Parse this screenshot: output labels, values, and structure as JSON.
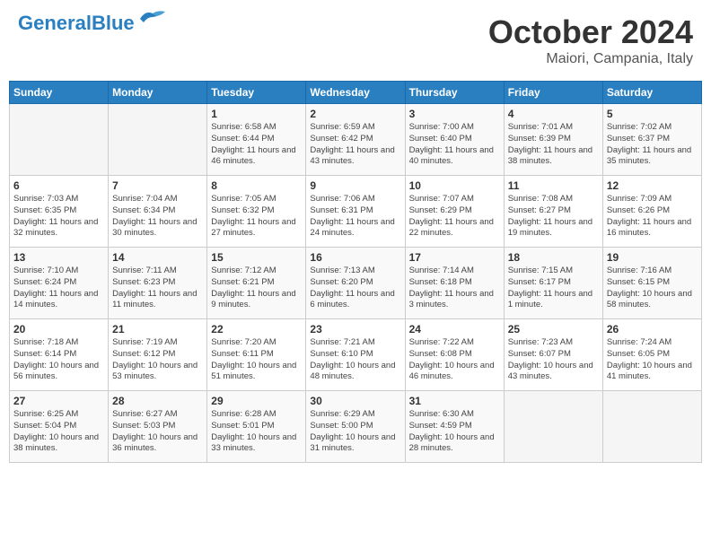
{
  "header": {
    "logo_general": "General",
    "logo_blue": "Blue",
    "title": "October 2024",
    "location": "Maiori, Campania, Italy"
  },
  "calendar": {
    "days_of_week": [
      "Sunday",
      "Monday",
      "Tuesday",
      "Wednesday",
      "Thursday",
      "Friday",
      "Saturday"
    ],
    "weeks": [
      [
        {
          "day": "",
          "info": ""
        },
        {
          "day": "",
          "info": ""
        },
        {
          "day": "1",
          "info": "Sunrise: 6:58 AM\nSunset: 6:44 PM\nDaylight: 11 hours and 46 minutes."
        },
        {
          "day": "2",
          "info": "Sunrise: 6:59 AM\nSunset: 6:42 PM\nDaylight: 11 hours and 43 minutes."
        },
        {
          "day": "3",
          "info": "Sunrise: 7:00 AM\nSunset: 6:40 PM\nDaylight: 11 hours and 40 minutes."
        },
        {
          "day": "4",
          "info": "Sunrise: 7:01 AM\nSunset: 6:39 PM\nDaylight: 11 hours and 38 minutes."
        },
        {
          "day": "5",
          "info": "Sunrise: 7:02 AM\nSunset: 6:37 PM\nDaylight: 11 hours and 35 minutes."
        }
      ],
      [
        {
          "day": "6",
          "info": "Sunrise: 7:03 AM\nSunset: 6:35 PM\nDaylight: 11 hours and 32 minutes."
        },
        {
          "day": "7",
          "info": "Sunrise: 7:04 AM\nSunset: 6:34 PM\nDaylight: 11 hours and 30 minutes."
        },
        {
          "day": "8",
          "info": "Sunrise: 7:05 AM\nSunset: 6:32 PM\nDaylight: 11 hours and 27 minutes."
        },
        {
          "day": "9",
          "info": "Sunrise: 7:06 AM\nSunset: 6:31 PM\nDaylight: 11 hours and 24 minutes."
        },
        {
          "day": "10",
          "info": "Sunrise: 7:07 AM\nSunset: 6:29 PM\nDaylight: 11 hours and 22 minutes."
        },
        {
          "day": "11",
          "info": "Sunrise: 7:08 AM\nSunset: 6:27 PM\nDaylight: 11 hours and 19 minutes."
        },
        {
          "day": "12",
          "info": "Sunrise: 7:09 AM\nSunset: 6:26 PM\nDaylight: 11 hours and 16 minutes."
        }
      ],
      [
        {
          "day": "13",
          "info": "Sunrise: 7:10 AM\nSunset: 6:24 PM\nDaylight: 11 hours and 14 minutes."
        },
        {
          "day": "14",
          "info": "Sunrise: 7:11 AM\nSunset: 6:23 PM\nDaylight: 11 hours and 11 minutes."
        },
        {
          "day": "15",
          "info": "Sunrise: 7:12 AM\nSunset: 6:21 PM\nDaylight: 11 hours and 9 minutes."
        },
        {
          "day": "16",
          "info": "Sunrise: 7:13 AM\nSunset: 6:20 PM\nDaylight: 11 hours and 6 minutes."
        },
        {
          "day": "17",
          "info": "Sunrise: 7:14 AM\nSunset: 6:18 PM\nDaylight: 11 hours and 3 minutes."
        },
        {
          "day": "18",
          "info": "Sunrise: 7:15 AM\nSunset: 6:17 PM\nDaylight: 11 hours and 1 minute."
        },
        {
          "day": "19",
          "info": "Sunrise: 7:16 AM\nSunset: 6:15 PM\nDaylight: 10 hours and 58 minutes."
        }
      ],
      [
        {
          "day": "20",
          "info": "Sunrise: 7:18 AM\nSunset: 6:14 PM\nDaylight: 10 hours and 56 minutes."
        },
        {
          "day": "21",
          "info": "Sunrise: 7:19 AM\nSunset: 6:12 PM\nDaylight: 10 hours and 53 minutes."
        },
        {
          "day": "22",
          "info": "Sunrise: 7:20 AM\nSunset: 6:11 PM\nDaylight: 10 hours and 51 minutes."
        },
        {
          "day": "23",
          "info": "Sunrise: 7:21 AM\nSunset: 6:10 PM\nDaylight: 10 hours and 48 minutes."
        },
        {
          "day": "24",
          "info": "Sunrise: 7:22 AM\nSunset: 6:08 PM\nDaylight: 10 hours and 46 minutes."
        },
        {
          "day": "25",
          "info": "Sunrise: 7:23 AM\nSunset: 6:07 PM\nDaylight: 10 hours and 43 minutes."
        },
        {
          "day": "26",
          "info": "Sunrise: 7:24 AM\nSunset: 6:05 PM\nDaylight: 10 hours and 41 minutes."
        }
      ],
      [
        {
          "day": "27",
          "info": "Sunrise: 6:25 AM\nSunset: 5:04 PM\nDaylight: 10 hours and 38 minutes."
        },
        {
          "day": "28",
          "info": "Sunrise: 6:27 AM\nSunset: 5:03 PM\nDaylight: 10 hours and 36 minutes."
        },
        {
          "day": "29",
          "info": "Sunrise: 6:28 AM\nSunset: 5:01 PM\nDaylight: 10 hours and 33 minutes."
        },
        {
          "day": "30",
          "info": "Sunrise: 6:29 AM\nSunset: 5:00 PM\nDaylight: 10 hours and 31 minutes."
        },
        {
          "day": "31",
          "info": "Sunrise: 6:30 AM\nSunset: 4:59 PM\nDaylight: 10 hours and 28 minutes."
        },
        {
          "day": "",
          "info": ""
        },
        {
          "day": "",
          "info": ""
        }
      ]
    ]
  }
}
